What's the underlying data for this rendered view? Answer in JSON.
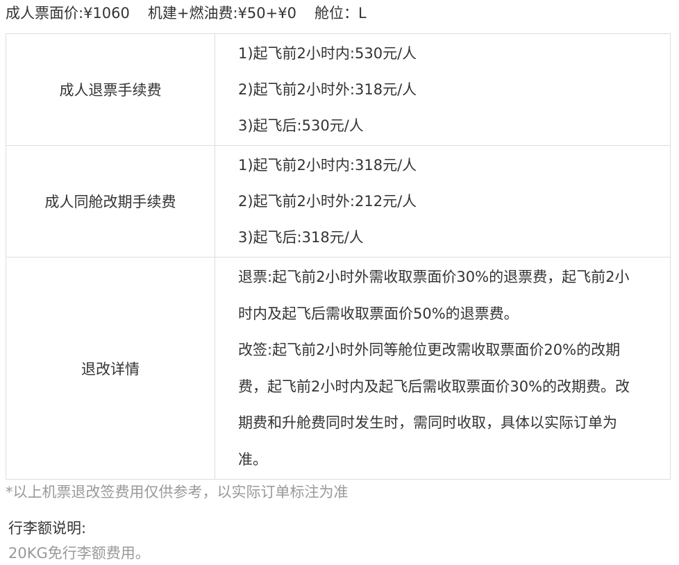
{
  "header": {
    "fare": "成人票面价:¥1060",
    "tax": "机建+燃油费:¥50+¥0",
    "cabin": "舱位：L"
  },
  "refund_fee": {
    "label": "成人退票手续费",
    "lines": [
      "1)起飞前2小时内:530元/人",
      "2)起飞前2小时外:318元/人",
      "3)起飞后:530元/人"
    ]
  },
  "change_fee": {
    "label": "成人同舱改期手续费",
    "lines": [
      "1)起飞前2小时内:318元/人",
      "2)起飞前2小时外:212元/人",
      "3)起飞后:318元/人"
    ]
  },
  "details": {
    "label": "退改详情",
    "refund_text": "退票:起飞前2小时外需收取票面价30%的退票费，起飞前2小时内及起飞后需收取票面价50%的退票费。",
    "change_text": "改签:起飞前2小时外同等舱位更改需收取票面价20%的改期费，起飞前2小时内及起飞后需收取票面价30%的改期费。改期费和升舱费同时发生时，需同时收取，具体以实际订单为准。"
  },
  "note": "*以上机票退改签费用仅供参考，以实际订单标注为准",
  "baggage": {
    "title": "行李额说明:",
    "value": "20KG免行李额费用。"
  }
}
